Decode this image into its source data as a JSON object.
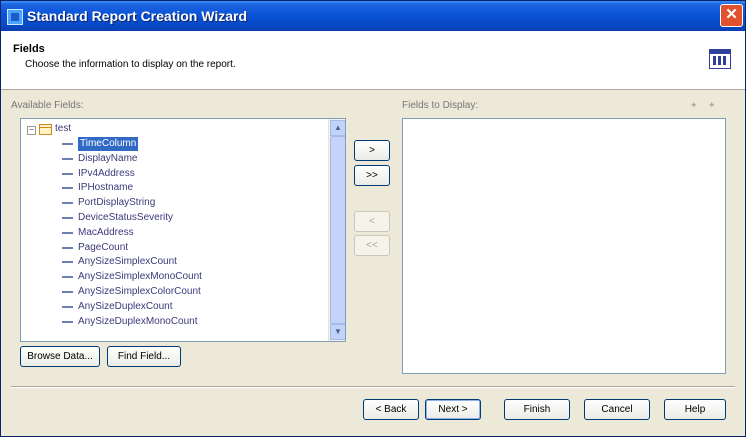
{
  "window": {
    "title": "Standard Report Creation Wizard",
    "close_label": "✕"
  },
  "header": {
    "title": "Fields",
    "subtitle": "Choose the information to display on the report."
  },
  "available": {
    "label": "Available Fields:",
    "table_name": "test",
    "fields": [
      "TimeColumn",
      "DisplayName",
      "IPv4Address",
      "IPHostname",
      "PortDisplayString",
      "DeviceStatusSeverity",
      "MacAddress",
      "PageCount",
      "AnySizeSimplexCount",
      "AnySizeSimplexMonoCount",
      "AnySizeSimplexColorCount",
      "AnySizeDuplexCount",
      "AnySizeDuplexMonoCount"
    ],
    "selected_index": 0
  },
  "display": {
    "label": "Fields to Display:"
  },
  "transfer": {
    "add": ">",
    "add_all": ">>",
    "remove": "<",
    "remove_all": "<<"
  },
  "lower_buttons": {
    "browse": "Browse Data...",
    "find": "Find Field..."
  },
  "footer": {
    "back": "< Back",
    "next": "Next >",
    "finish": "Finish",
    "cancel": "Cancel",
    "help": "Help"
  },
  "colors": {
    "title_bar": "#0a52d6",
    "selection": "#316ac5",
    "window_bg": "#ece9d8"
  }
}
